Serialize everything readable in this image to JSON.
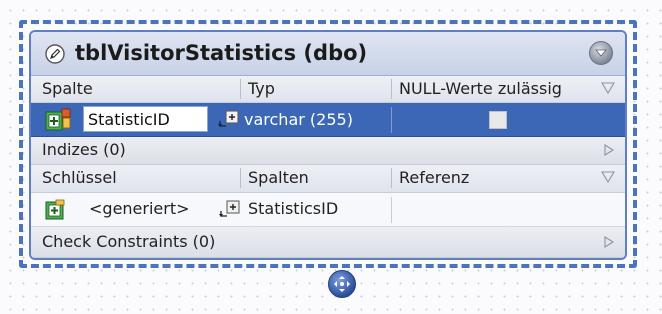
{
  "table": {
    "title": "tblVisitorStatistics (dbo)"
  },
  "columns_header": {
    "col1": "Spalte",
    "col2": "Typ",
    "col3": "NULL-Werte zulässig"
  },
  "columns": [
    {
      "name": "StatisticID",
      "type": "varchar (255)",
      "nullable": false
    }
  ],
  "indexes": {
    "label": "Indizes (0)"
  },
  "keys_header": {
    "col1": "Schlüssel",
    "col2": "Spalten",
    "col3": "Referenz"
  },
  "keys": [
    {
      "name": "<generiert>",
      "columns": "StatisticsID",
      "reference": ""
    }
  ],
  "check_constraints": {
    "label": "Check Constraints (0)"
  },
  "colors": {
    "selected_row": "#3c67b7",
    "frame": "#4a74c0"
  },
  "icons": {
    "title": "pencil-icon",
    "collapse": "collapse-icon",
    "column_row": "primary-key-column-icon",
    "key_row": "key-icon",
    "filter": "filter-icon",
    "expand": "expand-icon"
  }
}
